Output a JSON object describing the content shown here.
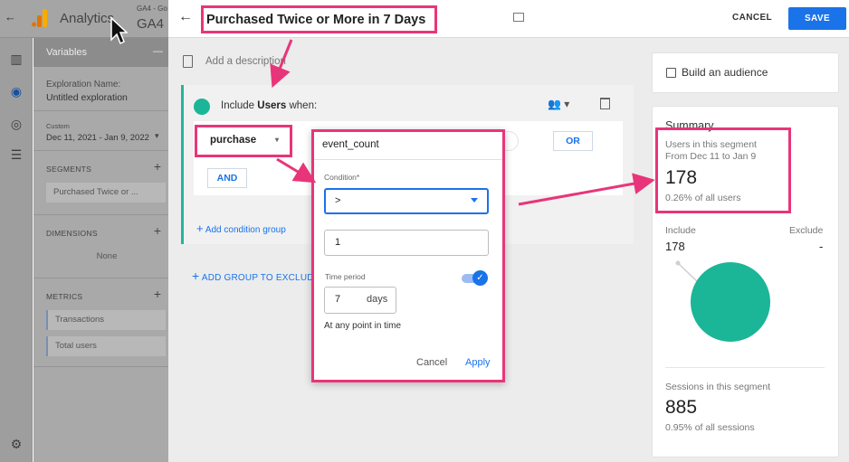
{
  "shell": {
    "app_name": "Analytics",
    "property_top": "GA4 - Go",
    "property_big": "GA4",
    "variables_title": "Variables",
    "exploration_name_label": "Exploration Name:",
    "exploration_name_value": "Untitled exploration",
    "date_custom": "Custom",
    "date_range": "Dec 11, 2021 - Jan 9, 2022",
    "segments_label": "SEGMENTS",
    "segment_item": "Purchased Twice or ...",
    "dimensions_label": "DIMENSIONS",
    "dimensions_value": "None",
    "metrics_label": "METRICS",
    "metric_1": "Transactions",
    "metric_2": "Total users"
  },
  "header": {
    "title": "Purchased Twice or More in 7 Days",
    "cancel_label": "CANCEL",
    "save_label": "SAVE"
  },
  "builder": {
    "description_placeholder": "Add a description",
    "include_prefix": "Include",
    "include_entity": "Users",
    "include_suffix": "when:",
    "event_name": "purchase",
    "or_label": "OR",
    "and_label": "AND",
    "add_condition_group": "Add condition group",
    "add_group_exclude": "ADD GROUP TO EXCLUD"
  },
  "popup": {
    "title": "event_count",
    "condition_label": "Condition*",
    "condition_value": ">",
    "value": "1",
    "time_period_label": "Time period",
    "toggle_on": true,
    "days_value": "7",
    "days_unit": "days",
    "any_point_label": "At any point in time",
    "cancel_label": "Cancel",
    "apply_label": "Apply"
  },
  "summary": {
    "build_audience_label": "Build an audience",
    "title": "Summary",
    "users_label": "Users in this segment",
    "users_range": "From Dec 11 to Jan 9",
    "users_count": "178",
    "users_pct": "0.26% of all users",
    "include_label": "Include",
    "exclude_label": "Exclude",
    "include_value": "178",
    "exclude_value": "-",
    "sessions_label": "Sessions in this segment",
    "sessions_count": "885",
    "sessions_pct": "0.95% of all sessions"
  },
  "colors": {
    "highlight": "#e8357a",
    "accent_blue": "#1a73e8",
    "segment_green": "#1bb597"
  }
}
